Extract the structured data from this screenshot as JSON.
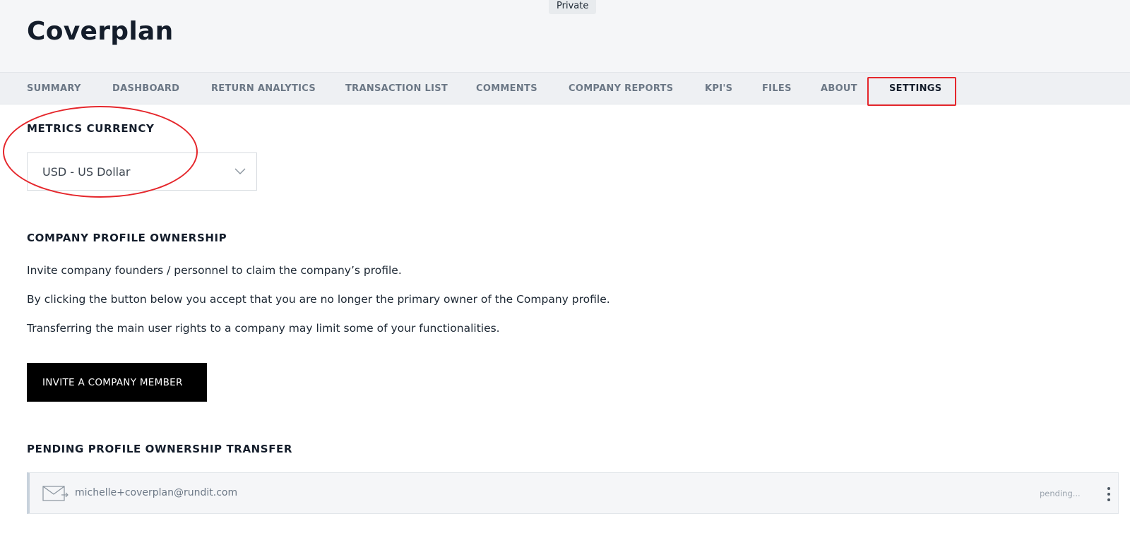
{
  "header": {
    "visibility_badge": "Private",
    "title": "Coverplan"
  },
  "nav": {
    "tabs": [
      {
        "label": "SUMMARY"
      },
      {
        "label": "DASHBOARD"
      },
      {
        "label": "RETURN ANALYTICS"
      },
      {
        "label": "TRANSACTION LIST"
      },
      {
        "label": "COMMENTS"
      },
      {
        "label": "COMPANY REPORTS"
      },
      {
        "label": "KPI'S"
      },
      {
        "label": "FILES"
      },
      {
        "label": "ABOUT"
      },
      {
        "label": "SETTINGS",
        "active": true
      }
    ]
  },
  "metrics_currency": {
    "title": "METRICS CURRENCY",
    "selected": "USD - US Dollar"
  },
  "ownership": {
    "title": "COMPANY PROFILE OWNERSHIP",
    "lines": [
      "Invite company founders / personnel to claim the company’s profile.",
      "By clicking the button below you accept that you are no longer the primary owner of the Company profile.",
      "Transferring the main user rights to a company may limit some of your functionalities."
    ],
    "invite_button": "INVITE A COMPANY MEMBER"
  },
  "pending": {
    "title": "PENDING PROFILE OWNERSHIP TRANSFER",
    "items": [
      {
        "email": "michelle+coverplan@rundit.com",
        "status": "pending..."
      }
    ]
  },
  "icons": {
    "select_chevron": "chevron-down-icon",
    "pending_item": "mail-arrow-icon",
    "row_menu": "more-vertical-icon"
  },
  "colors": {
    "annotation": "#e5262b",
    "button_bg": "#000000",
    "header_bg": "#f5f6f8"
  }
}
